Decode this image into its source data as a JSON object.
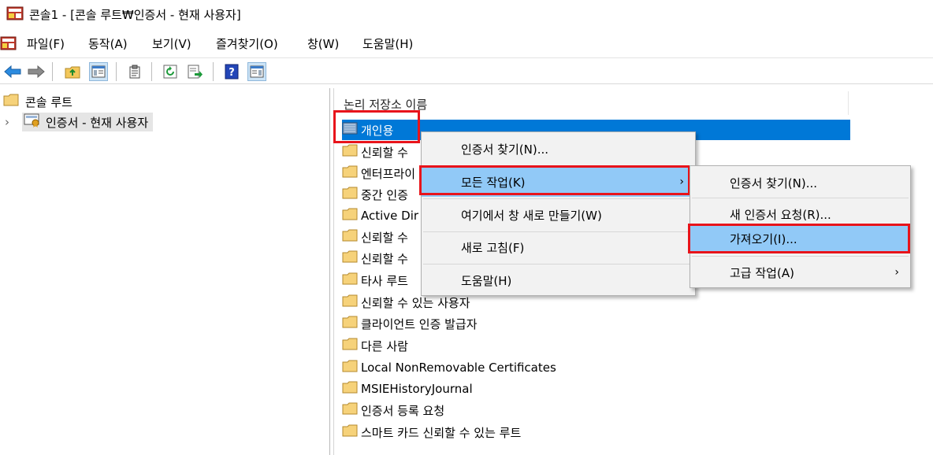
{
  "window": {
    "title": "콘솔1 - [콘솔 루트₩인증서 - 현재 사용자]"
  },
  "menubar": {
    "items": [
      "파일(F)",
      "동작(A)",
      "보기(V)",
      "즐겨찾기(O)",
      "창(W)",
      "도움말(H)"
    ]
  },
  "toolbar": {
    "buttons": [
      "back-arrow-icon",
      "forward-arrow-icon",
      "up-folder-icon",
      "show-hide-tree-icon",
      "clipboard-icon",
      "refresh-icon",
      "export-list-icon",
      "help-icon",
      "show-hide-action-pane-icon"
    ]
  },
  "tree": {
    "root": "콘솔 루트",
    "child": "인증서 - 현재 사용자"
  },
  "list": {
    "header": "논리 저장소 이름",
    "items": [
      "개인용",
      "신뢰할 수",
      "엔터프라이",
      "중간 인증",
      "Active Dir",
      "신뢰할 수",
      "신뢰할 수",
      "타사 루트",
      "신뢰할 수 있는 사용자",
      "클라이언트 인증 발급자",
      "다른 사람",
      "Local NonRemovable Certificates",
      "MSIEHistoryJournal",
      "인증서 등록 요청",
      "스마트 카드 신뢰할 수 있는 루트"
    ]
  },
  "context_menu": {
    "items": [
      "인증서 찾기(N)...",
      "모든 작업(K)",
      "여기에서 창 새로 만들기(W)",
      "새로 고침(F)",
      "도움말(H)"
    ],
    "submenu_arrow": "›"
  },
  "submenu": {
    "items": [
      "인증서 찾기(N)...",
      "새 인증서 요청(R)...",
      "가져오기(I)...",
      "고급 작업(A)"
    ],
    "submenu_arrow": "›"
  },
  "colors": {
    "selection": "#0078d7",
    "menu_highlight": "#91c9f7",
    "annotation_red": "#e8141b",
    "menu_bg": "#f2f2f2"
  }
}
